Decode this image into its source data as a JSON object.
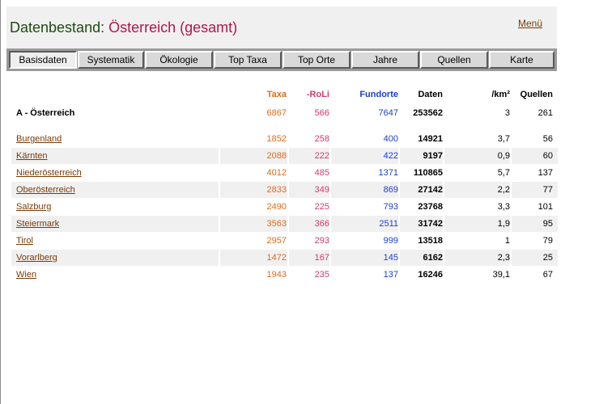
{
  "header": {
    "title_prefix": "Datenbestand:",
    "title_region": "Österreich (gesamt)",
    "menu_label": "Menü"
  },
  "tabs": [
    {
      "label": "Basisdaten",
      "active": true
    },
    {
      "label": "Systematik",
      "active": false
    },
    {
      "label": "Ökologie",
      "active": false
    },
    {
      "label": "Top Taxa",
      "active": false
    },
    {
      "label": "Top Orte",
      "active": false
    },
    {
      "label": "Jahre",
      "active": false
    },
    {
      "label": "Quellen",
      "active": false
    },
    {
      "label": "Karte",
      "active": false
    }
  ],
  "table": {
    "columns": [
      "Taxa",
      "-RoLi",
      "Fundorte",
      "Daten",
      "/km²",
      "Quellen"
    ],
    "total": {
      "name": "A - Österreich",
      "taxa": "6867",
      "roli": "566",
      "fundorte": "7647",
      "daten": "253562",
      "km2": "3",
      "quellen": "261"
    },
    "rows": [
      {
        "name": "Burgenland",
        "taxa": "1852",
        "roli": "258",
        "fundorte": "400",
        "daten": "14921",
        "km2": "3,7",
        "quellen": "56"
      },
      {
        "name": "Kärnten",
        "taxa": "2088",
        "roli": "222",
        "fundorte": "422",
        "daten": "9197",
        "km2": "0,9",
        "quellen": "60"
      },
      {
        "name": "Niederösterreich",
        "taxa": "4012",
        "roli": "485",
        "fundorte": "1371",
        "daten": "110865",
        "km2": "5,7",
        "quellen": "137"
      },
      {
        "name": "Oberösterreich",
        "taxa": "2833",
        "roli": "349",
        "fundorte": "869",
        "daten": "27142",
        "km2": "2,2",
        "quellen": "77"
      },
      {
        "name": "Salzburg",
        "taxa": "2490",
        "roli": "225",
        "fundorte": "793",
        "daten": "23768",
        "km2": "3,3",
        "quellen": "101"
      },
      {
        "name": "Steiermark",
        "taxa": "3563",
        "roli": "366",
        "fundorte": "2511",
        "daten": "31742",
        "km2": "1,9",
        "quellen": "95"
      },
      {
        "name": "Tirol",
        "taxa": "2957",
        "roli": "293",
        "fundorte": "999",
        "daten": "13518",
        "km2": "1",
        "quellen": "79"
      },
      {
        "name": "Vorarlberg",
        "taxa": "1472",
        "roli": "167",
        "fundorte": "145",
        "daten": "6162",
        "km2": "2,3",
        "quellen": "25"
      },
      {
        "name": "Wien",
        "taxa": "1943",
        "roli": "235",
        "fundorte": "137",
        "daten": "16246",
        "km2": "39,1",
        "quellen": "67"
      }
    ]
  },
  "colors": {
    "title_prefix": "#1f4a12",
    "title_region": "#b0174a",
    "taxa": "#e06b1a",
    "roli": "#d03a6e",
    "fundorte": "#1a3fd0",
    "link": "#7a3a05"
  }
}
